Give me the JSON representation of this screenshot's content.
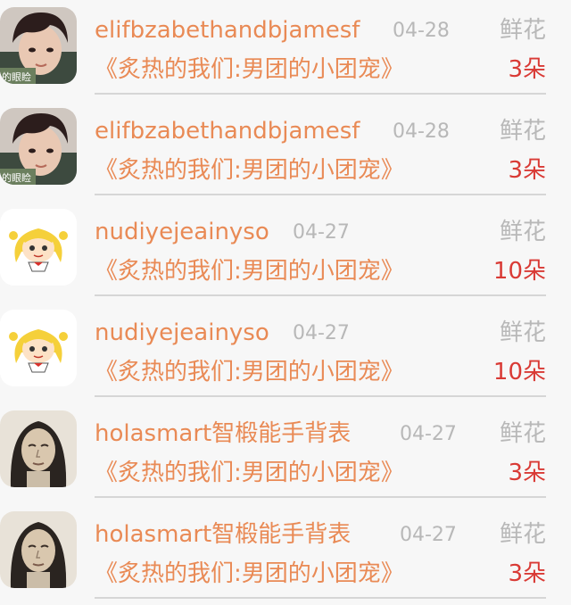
{
  "records": [
    {
      "user": "elifbzabethandbjamesf",
      "date": "04-28",
      "gift": "鲜花",
      "book": "《炙热的我们:男团的小团宠》",
      "count": "3朵",
      "avatar": "boy-photo",
      "avatar_caption": "的眼睑"
    },
    {
      "user": "elifbzabethandbjamesf",
      "date": "04-28",
      "gift": "鲜花",
      "book": "《炙热的我们:男团的小团宠》",
      "count": "3朵",
      "avatar": "boy-photo",
      "avatar_caption": "的眼睑"
    },
    {
      "user": "nudiyejeainyso",
      "date": "04-27",
      "gift": "鲜花",
      "book": "《炙热的我们:男团的小团宠》",
      "count": "10朵",
      "avatar": "cartoon-girl"
    },
    {
      "user": "nudiyejeainyso",
      "date": "04-27",
      "gift": "鲜花",
      "book": "《炙热的我们:男团的小团宠》",
      "count": "10朵",
      "avatar": "cartoon-girl"
    },
    {
      "user": "holasmart智椴能手背表",
      "date": "04-27",
      "gift": "鲜花",
      "book": "《炙热的我们:男团的小团宠》",
      "count": "3朵",
      "avatar": "sketch-portrait"
    },
    {
      "user": "holasmart智椴能手背表",
      "date": "04-27",
      "gift": "鲜花",
      "book": "《炙热的我们:男团的小团宠》",
      "count": "3朵",
      "avatar": "sketch-portrait"
    }
  ],
  "colors": {
    "username": "#e98a55",
    "book": "#e98a55",
    "date": "#b8b8b8",
    "gift": "#b8b8b8",
    "count": "#d93a35",
    "divider": "#d6d6d6",
    "background": "#f7f7f7"
  }
}
